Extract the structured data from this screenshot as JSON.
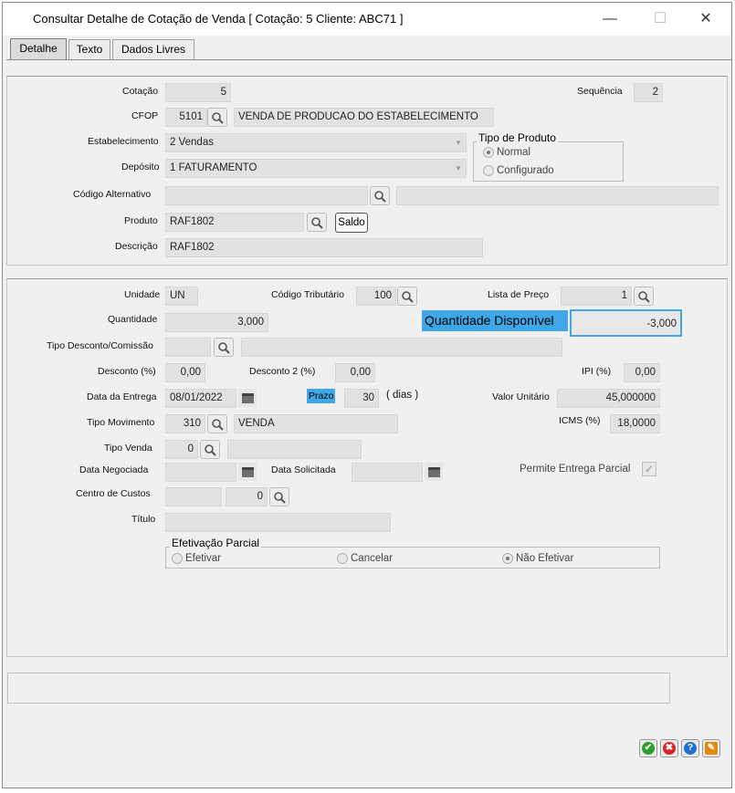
{
  "window": {
    "title": "Consultar Detalhe de Cotação de Venda [ Cotação: 5  Cliente: ABC71 ]",
    "minimize": "—",
    "maximize": "☐",
    "close": "✕"
  },
  "tabs": [
    "Detalhe",
    "Texto",
    "Dados Livres"
  ],
  "header": {
    "cotacao_label": "Cotação",
    "cotacao_value": "5",
    "sequencia_label": "Sequência",
    "sequencia_value": "2",
    "cfop_label": "CFOP",
    "cfop_value": "5101",
    "cfop_desc": "VENDA DE PRODUCAO DO ESTABELECIMENTO",
    "estabelecimento_label": "Estabelecimento",
    "estabelecimento_value": "2 Vendas",
    "deposito_label": "Depósito",
    "deposito_value": "1 FATURAMENTO",
    "tipo_produto_label": "Tipo de Produto",
    "tipo_normal": "Normal",
    "tipo_configurado": "Configurado",
    "codigo_alternativo_label": "Código Alternativo",
    "produto_label": "Produto",
    "produto_value": "RAF1802",
    "saldo_button": "Saldo",
    "descricao_label": "Descrição",
    "descricao_value": "RAF1802"
  },
  "detail": {
    "unidade_label": "Unidade",
    "unidade_value": "UN",
    "codigo_tributario_label": "Código Tributário",
    "codigo_tributario_value": "100",
    "lista_preco_label": "Lista de Preço",
    "lista_preco_value": "1",
    "quantidade_label": "Quantidade",
    "quantidade_value": "3,000",
    "quantidade_disponivel_label": "Quantidade Disponível",
    "quantidade_disponivel_value": "-3,000",
    "tipo_desconto_label": "Tipo Desconto/Comissão",
    "desconto_label": "Desconto (%)",
    "desconto_value": "0,00",
    "desconto2_label": "Desconto 2 (%)",
    "desconto2_value": "0,00",
    "ipi_label": "IPI (%)",
    "ipi_value": "0,00",
    "data_entrega_label": "Data da Entrega",
    "data_entrega_value": "08/01/2022",
    "prazo_label": "Prazo",
    "prazo_value": "30",
    "prazo_unit": "( dias )",
    "valor_unitario_label": "Valor Unitário",
    "valor_unitario_value": "45,000000",
    "tipo_movimento_label": "Tipo Movimento",
    "tipo_movimento_value": "310",
    "tipo_movimento_desc": "VENDA",
    "icms_label": "ICMS (%)",
    "icms_value": "18,0000",
    "tipo_venda_label": "Tipo Venda",
    "tipo_venda_value": "0",
    "data_negociada_label": "Data Negociada",
    "data_solicitada_label": "Data Solicitada",
    "permite_entrega_label": "Permite Entrega Parcial",
    "permite_entrega_check": "✓",
    "centro_custos_label": "Centro de Custos",
    "centro_custos_value": "0",
    "titulo_label": "Título",
    "efetivacao_label": "Efetivação Parcial",
    "efetivar": "Efetivar",
    "cancelar": "Cancelar",
    "nao_efetivar": "Não Efetivar"
  },
  "actions": {
    "ok": "✔",
    "cancel": "✖",
    "help": "?",
    "tools": "✎"
  },
  "colors": {
    "highlight": "#3fa7e6",
    "ok": "#2e9e2e",
    "cancel": "#d62828",
    "help": "#1f6fd0",
    "tools": "#e08a14"
  }
}
